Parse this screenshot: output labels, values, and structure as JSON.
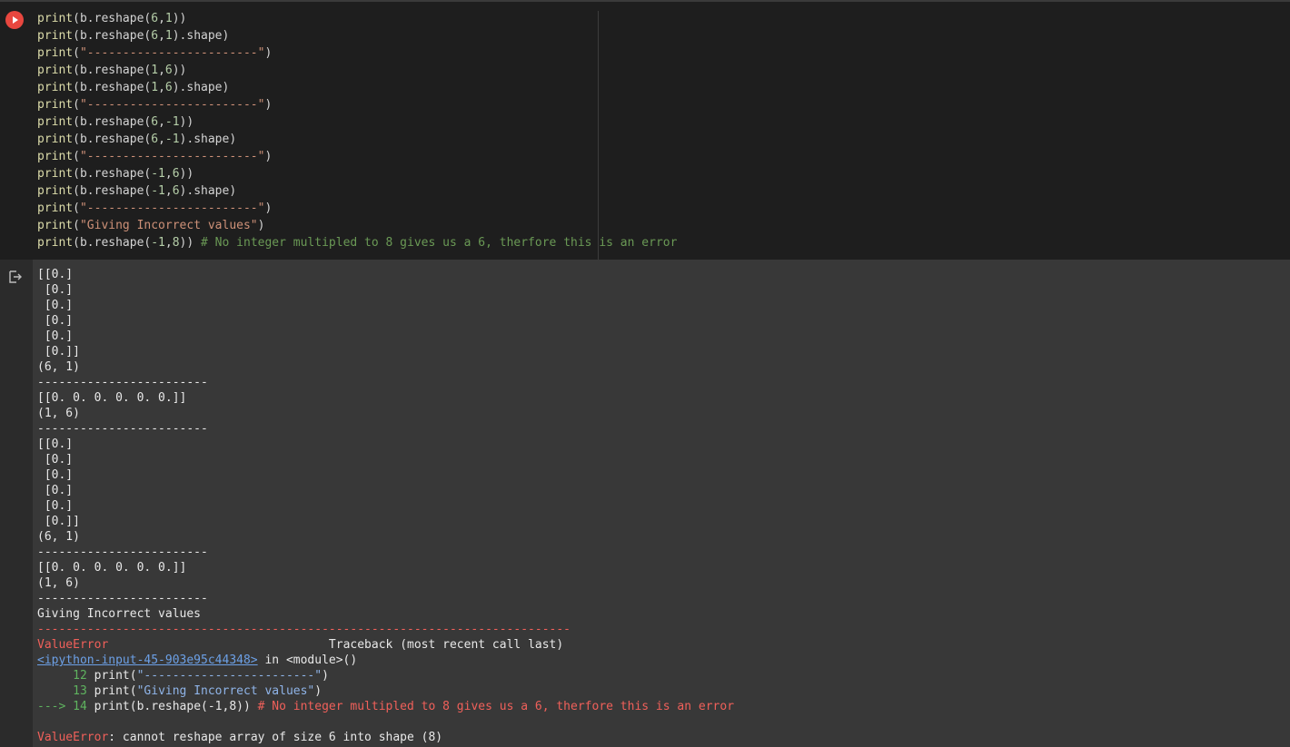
{
  "code_cell": {
    "run_icon": "play-icon",
    "lines": [
      {
        "fn": "print",
        "open": "(b.reshape(",
        "a": "6",
        "sep": ",",
        "b": "1",
        "close": "))",
        "str": "",
        "tail": "",
        "comment": ""
      },
      {
        "fn": "print",
        "open": "(b.reshape(",
        "a": "6",
        "sep": ",",
        "b": "1",
        "close": ").shape)",
        "str": "",
        "tail": "",
        "comment": ""
      },
      {
        "fn": "print",
        "open": "(",
        "a": "",
        "sep": "",
        "b": "",
        "close": "",
        "str": "\"------------------------\"",
        "tail": ")",
        "comment": ""
      },
      {
        "fn": "print",
        "open": "(b.reshape(",
        "a": "1",
        "sep": ",",
        "b": "6",
        "close": "))",
        "str": "",
        "tail": "",
        "comment": ""
      },
      {
        "fn": "print",
        "open": "(b.reshape(",
        "a": "1",
        "sep": ",",
        "b": "6",
        "close": ").shape)",
        "str": "",
        "tail": "",
        "comment": ""
      },
      {
        "fn": "print",
        "open": "(",
        "a": "",
        "sep": "",
        "b": "",
        "close": "",
        "str": "\"------------------------\"",
        "tail": ")",
        "comment": ""
      },
      {
        "fn": "print",
        "open": "(b.reshape(",
        "a": "6",
        "sep": ",",
        "b": "-1",
        "close": "))",
        "str": "",
        "tail": "",
        "comment": ""
      },
      {
        "fn": "print",
        "open": "(b.reshape(",
        "a": "6",
        "sep": ",",
        "b": "-1",
        "close": ").shape)",
        "str": "",
        "tail": "",
        "comment": ""
      },
      {
        "fn": "print",
        "open": "(",
        "a": "",
        "sep": "",
        "b": "",
        "close": "",
        "str": "\"------------------------\"",
        "tail": ")",
        "comment": ""
      },
      {
        "fn": "print",
        "open": "(b.reshape(",
        "a": "-1",
        "sep": ",",
        "b": "6",
        "close": "))",
        "str": "",
        "tail": "",
        "comment": ""
      },
      {
        "fn": "print",
        "open": "(b.reshape(",
        "a": "-1",
        "sep": ",",
        "b": "6",
        "close": ").shape)",
        "str": "",
        "tail": "",
        "comment": ""
      },
      {
        "fn": "print",
        "open": "(",
        "a": "",
        "sep": "",
        "b": "",
        "close": "",
        "str": "\"------------------------\"",
        "tail": ")",
        "comment": ""
      },
      {
        "fn": "print",
        "open": "(",
        "a": "",
        "sep": "",
        "b": "",
        "close": "",
        "str": "\"Giving Incorrect values\"",
        "tail": ")",
        "comment": ""
      },
      {
        "fn": "print",
        "open": "(b.reshape(",
        "a": "-1",
        "sep": ",",
        "b": "8",
        "close": ")) ",
        "str": "",
        "tail": "",
        "comment": "# No integer multipled to 8 gives us a 6, therfore this is an error"
      }
    ]
  },
  "output": {
    "icon": "output-redirect-icon",
    "lines": [
      "[[0.]",
      " [0.]",
      " [0.]",
      " [0.]",
      " [0.]",
      " [0.]]",
      "(6, 1)",
      "------------------------",
      "[[0. 0. 0. 0. 0. 0.]]",
      "(1, 6)",
      "------------------------",
      "[[0.]",
      " [0.]",
      " [0.]",
      " [0.]",
      " [0.]",
      " [0.]]",
      "(6, 1)",
      "------------------------",
      "[[0. 0. 0. 0. 0. 0.]]",
      "(1, 6)",
      "------------------------",
      "Giving Incorrect values"
    ],
    "traceback": {
      "rule": "---------------------------------------------------------------------------",
      "error_name": "ValueError",
      "header_gap": "                               ",
      "header_text": "Traceback (most recent call last)",
      "link": "<ipython-input-45-903e95c44348>",
      "in_module": " in <module>()",
      "lines": [
        {
          "prefix": "     ",
          "num": "12",
          "code_pre": " print(",
          "code_str": "\"------------------------\"",
          "code_post": ")",
          "comment": ""
        },
        {
          "prefix": "     ",
          "num": "13",
          "code_pre": " print(",
          "code_str": "\"Giving Incorrect values\"",
          "code_post": ")",
          "comment": ""
        },
        {
          "prefix": "---> ",
          "num": "14",
          "code_pre": " print(b.reshape(-1,8)) ",
          "code_str": "",
          "code_post": "",
          "comment": "# No integer multipled to 8 gives us a 6, therfore this is an error"
        }
      ],
      "final_error_name": "ValueError",
      "final_message": ": cannot reshape array of size 6 into shape (8)"
    }
  }
}
